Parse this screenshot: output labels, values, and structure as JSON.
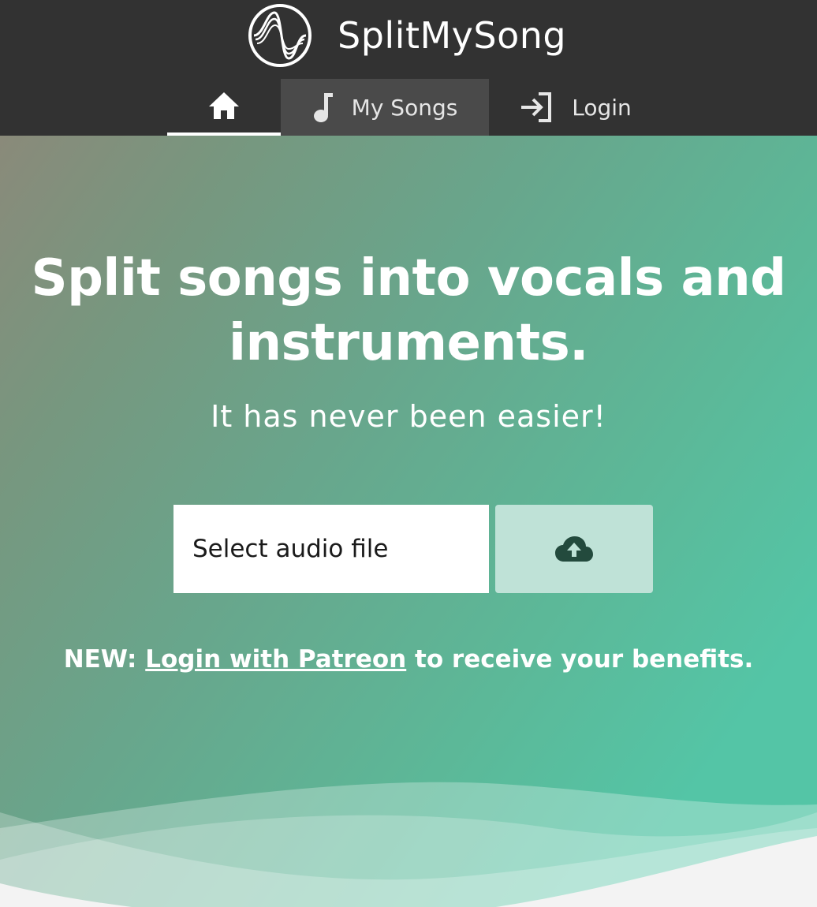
{
  "header": {
    "brand_name": "SplitMySong",
    "logo_icon": "sine-wave-logo-icon"
  },
  "nav": {
    "items": [
      {
        "label": "",
        "icon": "home-icon",
        "active": true
      },
      {
        "label": "My Songs",
        "icon": "music-note-icon",
        "active": false
      },
      {
        "label": "Login",
        "icon": "login-icon",
        "active": false
      }
    ]
  },
  "hero": {
    "headline": "Split songs into vocals and instruments.",
    "subheadline": "It has never been easier!",
    "file_input": {
      "label": "Select audio file"
    },
    "upload_icon": "cloud-upload-icon",
    "notice_prefix": "NEW: ",
    "notice_link": "Login with Patreon",
    "notice_suffix": " to receive your benefits."
  },
  "colors": {
    "header_bg": "#323232",
    "nav_active_bg": "#4a4a4a",
    "hero_gradient_start": "#8a8a7a",
    "hero_gradient_end": "#54c5a6",
    "upload_button_bg": "#bfe2d7",
    "page_bg": "#f3f3f3"
  }
}
